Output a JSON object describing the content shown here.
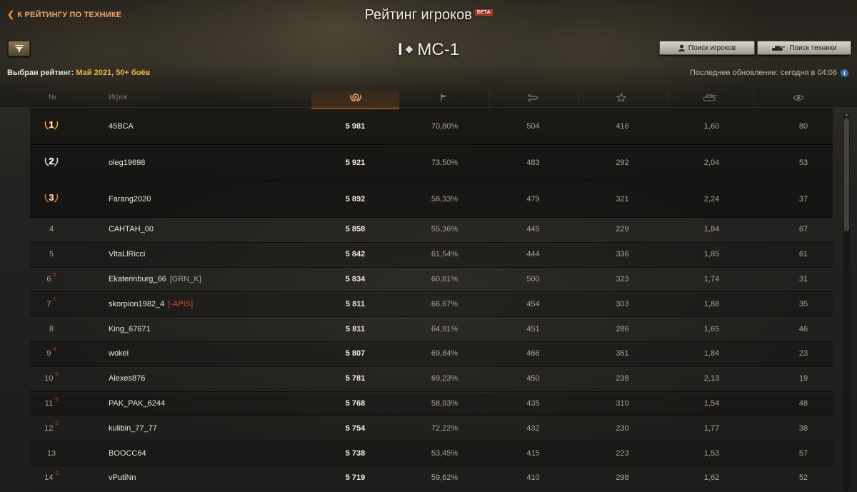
{
  "nav": {
    "back_label": "К РЕЙТИНГУ ПО ТЕХНИКЕ"
  },
  "header": {
    "title": "Рейтинг игроков",
    "beta": "БЕТА"
  },
  "tank": {
    "tier": "I",
    "name": "МС-1"
  },
  "buttons": {
    "players_search": "Поиск игроков",
    "tech_search": "Поиск техники"
  },
  "rating": {
    "label": "Выбран рейтинг:",
    "value": "Май 2021, 50+ боёв"
  },
  "update": {
    "text": "Последнее обновление: сегодня в 04:06"
  },
  "columns": {
    "rank": "№",
    "player": "Игрок"
  },
  "colors": {
    "accent": "#e0752a",
    "gold": "#e8b84a",
    "negative_change": "#d7332b"
  },
  "icons": {
    "score": "laurel-icon",
    "wins": "flag-icon",
    "damage": "shells-icon",
    "experience": "star-icon",
    "kills": "tank-kill-icon",
    "spotting": "eye-icon"
  },
  "rows": [
    {
      "rank": "1",
      "medal": "gold",
      "player": "45BCA",
      "clan": "",
      "score": "5 981",
      "win": "70,80%",
      "dmg": "504",
      "exp": "416",
      "kills": "1,60",
      "spot": "80"
    },
    {
      "rank": "2",
      "medal": "silver",
      "player": "oleg19698",
      "clan": "",
      "score": "5 921",
      "win": "73,50%",
      "dmg": "483",
      "exp": "292",
      "kills": "2,04",
      "spot": "53"
    },
    {
      "rank": "3",
      "medal": "bronze",
      "player": "Farang2020",
      "clan": "",
      "score": "5 892",
      "win": "58,33%",
      "dmg": "479",
      "exp": "321",
      "kills": "2,24",
      "spot": "37"
    },
    {
      "rank": "4",
      "change": "",
      "player": "САНТАН_00",
      "clan": "",
      "score": "5 858",
      "win": "55,36%",
      "dmg": "445",
      "exp": "229",
      "kills": "1,84",
      "spot": "67"
    },
    {
      "rank": "5",
      "change": "",
      "player": "VltaLlRicci",
      "clan": "",
      "score": "5 842",
      "win": "61,54%",
      "dmg": "444",
      "exp": "336",
      "kills": "1,85",
      "spot": "61"
    },
    {
      "rank": "6",
      "change": "-2",
      "player": "Ekaterinburg_66",
      "clan": "[GRN_K]",
      "score": "5 834",
      "win": "60,81%",
      "dmg": "500",
      "exp": "323",
      "kills": "1,74",
      "spot": "31"
    },
    {
      "rank": "7",
      "change": "-1",
      "player": "skorpion1982_4",
      "clan": "[-APIS]",
      "clan_red": true,
      "score": "5 811",
      "win": "66,67%",
      "dmg": "454",
      "exp": "303",
      "kills": "1,88",
      "spot": "35"
    },
    {
      "rank": "8",
      "change": "",
      "player": "King_67671",
      "clan": "",
      "score": "5 811",
      "win": "64,91%",
      "dmg": "451",
      "exp": "286",
      "kills": "1,65",
      "spot": "46"
    },
    {
      "rank": "9",
      "change": "-4",
      "player": "wokei",
      "clan": "",
      "score": "5 807",
      "win": "69,84%",
      "dmg": "466",
      "exp": "361",
      "kills": "1,84",
      "spot": "23"
    },
    {
      "rank": "10",
      "change": "-3",
      "player": "Alexes876",
      "clan": "",
      "score": "5 781",
      "win": "69,23%",
      "dmg": "450",
      "exp": "238",
      "kills": "2,13",
      "spot": "19"
    },
    {
      "rank": "11",
      "change": "-3",
      "player": "PAK_PAK_6244",
      "clan": "",
      "score": "5 768",
      "win": "58,93%",
      "dmg": "435",
      "exp": "310",
      "kills": "1,54",
      "spot": "48"
    },
    {
      "rank": "12",
      "change": "-2",
      "player": "kulibin_77_77",
      "clan": "",
      "score": "5 754",
      "win": "72,22%",
      "dmg": "432",
      "exp": "230",
      "kills": "1,77",
      "spot": "38"
    },
    {
      "rank": "13",
      "change": "",
      "player": "BOOCC64",
      "clan": "",
      "score": "5 738",
      "win": "53,45%",
      "dmg": "415",
      "exp": "223",
      "kills": "1,53",
      "spot": "57"
    },
    {
      "rank": "14",
      "change": "-3",
      "player": "vPutiNn",
      "clan": "",
      "score": "5 719",
      "win": "59,62%",
      "dmg": "410",
      "exp": "298",
      "kills": "1,62",
      "spot": "52"
    }
  ]
}
